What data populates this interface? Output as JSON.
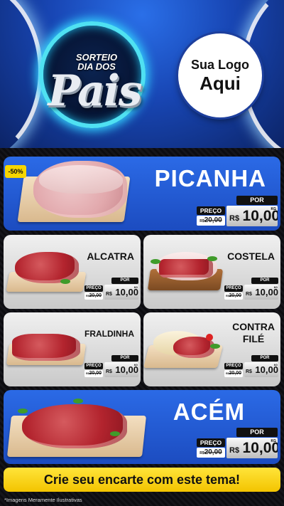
{
  "header": {
    "seal_top": "SORTEIO\nDIA DOS",
    "seal_main": "Pais",
    "logo_line1": "Sua Logo",
    "logo_line2": "Aqui"
  },
  "products": {
    "picanha": {
      "name": "PICANHA",
      "discount": "-50%",
      "por": "POR",
      "preco": "PREÇO",
      "old_prefix": "R$",
      "old_price": "20,00",
      "currency": "R$",
      "price": "10,00",
      "unit": "KG"
    },
    "alcatra": {
      "name": "ALCATRA",
      "por": "POR",
      "preco": "PREÇO",
      "old_prefix": "R$",
      "old_price": "20,00",
      "currency": "R$",
      "price": "10,00",
      "unit": "KG"
    },
    "costela": {
      "name": "COSTELA",
      "por": "POR",
      "preco": "PREÇO",
      "old_prefix": "R$",
      "old_price": "20,00",
      "currency": "R$",
      "price": "10,00",
      "unit": "KG"
    },
    "fraldinha": {
      "name": "FRALDINHA",
      "por": "POR",
      "preco": "PREÇO",
      "old_prefix": "R$",
      "old_price": "20,00",
      "currency": "R$",
      "price": "10,00",
      "unit": "KG"
    },
    "contra_file": {
      "name_line1": "CONTRA",
      "name_line2": "FILÉ",
      "por": "POR",
      "preco": "PREÇO",
      "old_prefix": "R$",
      "old_price": "20,00",
      "currency": "R$",
      "price": "10,00",
      "unit": "KG"
    },
    "acem": {
      "name": "ACÉM",
      "por": "POR",
      "preco": "PREÇO",
      "old_prefix": "R$",
      "old_price": "20,00",
      "currency": "R$",
      "price": "10,00",
      "unit": "KG"
    }
  },
  "cta": "Crie seu encarte com este tema!",
  "disclaimer": "*Imagens Meramente Ilustrativas",
  "colors": {
    "accent_blue": "#2b6ae6",
    "cta_yellow": "#f3c400",
    "discount_yellow": "#f6d600"
  }
}
